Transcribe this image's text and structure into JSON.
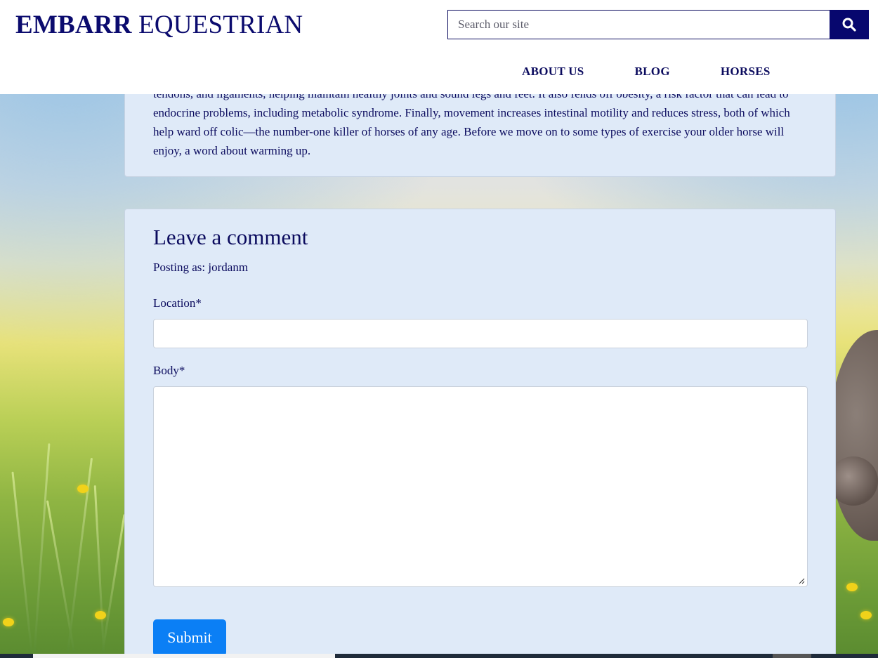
{
  "site": {
    "logo_bold": "EMBARR",
    "logo_rest": " EQUESTRIAN"
  },
  "search": {
    "placeholder": "Search our site",
    "button_icon": "search-icon"
  },
  "nav": {
    "items": [
      {
        "label": "ABOUT US"
      },
      {
        "label": "BLOG"
      },
      {
        "label": "HORSES"
      }
    ]
  },
  "article": {
    "text": "tendons, and ligaments, helping maintain healthy joints and sound legs and feet. It also fends off obesity, a risk factor that can lead to endocrine problems, including metabolic syndrome. Finally, movement increases intestinal motility and reduces stress, both of which help ward off colic—the number-one killer of horses of any age. Before we move on to some types of exercise your older horse will enjoy, a word about warming up."
  },
  "comment": {
    "title": "Leave a comment",
    "posting_as": "Posting as: jordanm",
    "location_label": "Location*",
    "location_value": "",
    "body_label": "Body*",
    "body_value": "",
    "submit_label": "Submit"
  },
  "colors": {
    "brand_navy": "#07076e",
    "submit_blue": "#0b7ff5",
    "card_bg": "#dfeaf8"
  }
}
